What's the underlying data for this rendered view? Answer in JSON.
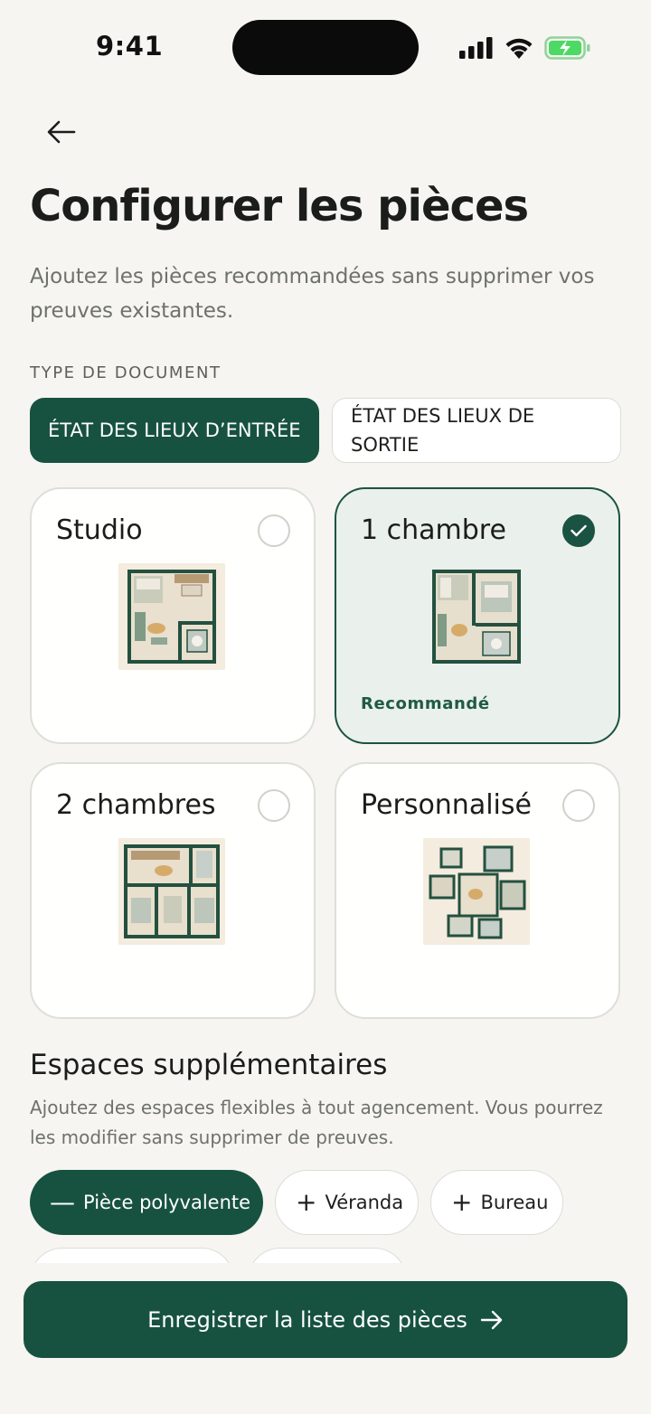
{
  "status_bar": {
    "time": "9:41"
  },
  "header": {
    "title": "Configurer les pièces",
    "subtitle": "Ajoutez les pièces recommandées sans supprimer vos preuves existantes."
  },
  "document_type": {
    "label": "TYPE DE DOCUMENT",
    "options": [
      {
        "label": "ÉTAT DES LIEUX D’ENTRÉE",
        "selected": true
      },
      {
        "label": "ÉTAT DES LIEUX DE SORTIE",
        "selected": false
      }
    ]
  },
  "layouts": [
    {
      "title": "Studio",
      "selected": false,
      "plan_icon": "studio-floorplan-icon"
    },
    {
      "title": "1 chambre",
      "selected": true,
      "badge": "Recommandé",
      "plan_icon": "one-bedroom-floorplan-icon"
    },
    {
      "title": "2 chambres",
      "selected": false,
      "plan_icon": "two-bedroom-floorplan-icon"
    },
    {
      "title": "Personnalisé",
      "selected": false,
      "plan_icon": "custom-floorplan-icon"
    }
  ],
  "extra_spaces": {
    "title": "Espaces supplémentaires",
    "description": "Ajoutez des espaces flexibles à tout agencement. Vous pourrez les modifier sans supprimer de preuves.",
    "chips": [
      {
        "label": "Pièce polyvalente",
        "added": true,
        "sign": "—"
      },
      {
        "label": "Véranda",
        "added": false,
        "sign": "+"
      },
      {
        "label": "Bureau",
        "added": false,
        "sign": "+"
      }
    ]
  },
  "cta": {
    "label": "Enregistrer la liste des pièces"
  },
  "colors": {
    "primary": "#175240",
    "background": "#f6f5f1",
    "selected_card": "#eaf0eb",
    "battery": "#4cd964"
  }
}
